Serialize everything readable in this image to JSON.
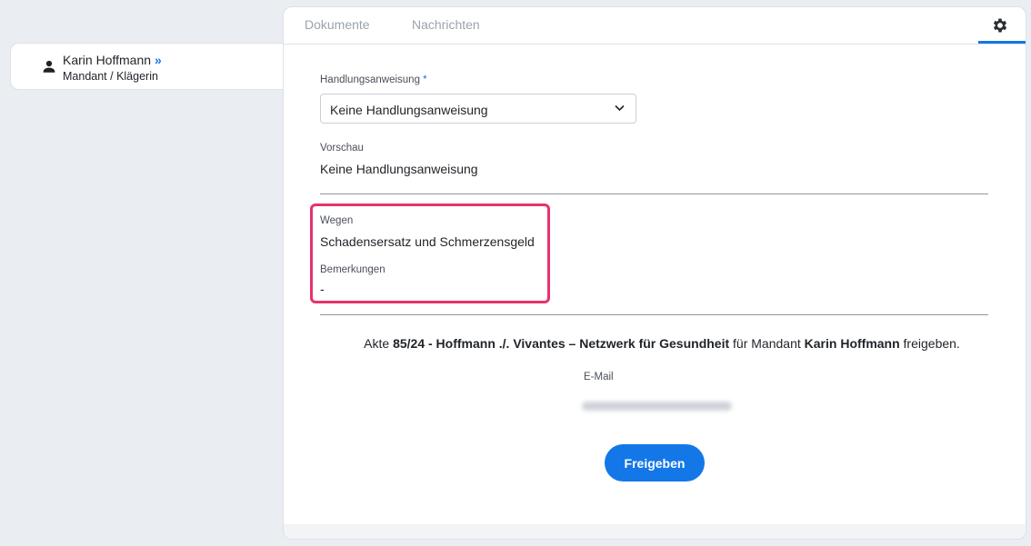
{
  "party": {
    "name": "Karin Hoffmann",
    "expand_glyph": "»",
    "role": "Mandant / Klägerin",
    "icon": "person-icon"
  },
  "tabs": [
    {
      "label": "Dokumente"
    },
    {
      "label": "Nachrichten"
    }
  ],
  "settings_icon": "gear-icon",
  "form": {
    "instruction_label": "Handlungsanweisung",
    "required_mark": "*",
    "instruction_value": "Keine Handlungsanweisung",
    "preview_label": "Vorschau",
    "preview_value": "Keine Handlungsanweisung",
    "regarding_label": "Wegen",
    "regarding_value": "Schadensersatz und Schmerzensgeld",
    "remarks_label": "Bemerkungen",
    "remarks_value": "-"
  },
  "share": {
    "prefix": "Akte",
    "case": "85/24 - Hoffmann ./. Vivantes – Netzwerk für Gesundheit",
    "middle": "für Mandant",
    "client": "Karin Hoffmann",
    "suffix": "freigeben.",
    "email_label": "E-Mail",
    "button_label": "Freigeben"
  },
  "colors": {
    "accent": "#1477e8",
    "highlight": "#e8326a"
  }
}
